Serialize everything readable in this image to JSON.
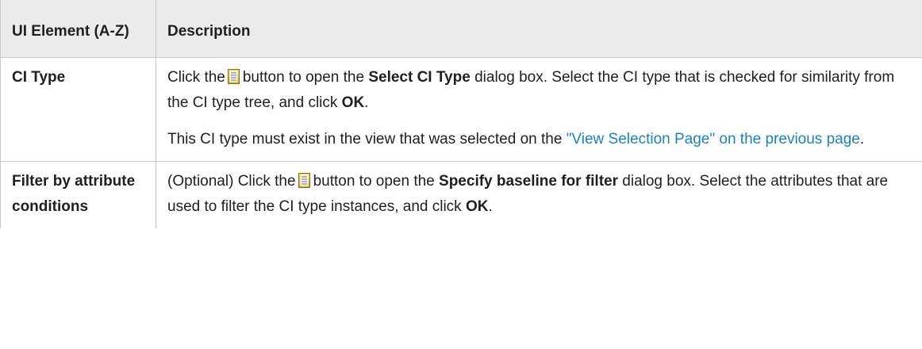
{
  "table": {
    "header": {
      "col1": "UI Element (A-Z)",
      "col2": "Description"
    },
    "rows": [
      {
        "element": "CI Type",
        "p1_before_icon": "Click the",
        "p1_after_icon": "button to open the",
        "p1_bold1": "Select CI Type",
        "p1_mid": "dialog box. Select the CI type that is checked for similarity from the CI type tree, and click",
        "p1_bold2": "OK",
        "p1_end": ".",
        "p2_text": "This CI type must exist in the view that was selected on the",
        "p2_link": "\"View Selection Page\" on the previous page",
        "p2_end": "."
      },
      {
        "element": "Filter by attribute conditions",
        "p1_before_icon": "(Optional) Click the",
        "p1_after_icon": "button to open the",
        "p1_bold1": "Specify baseline for filter",
        "p1_mid": "dialog box. Select the attributes that are used to filter the CI type instances, and click",
        "p1_bold2": "OK",
        "p1_end": "."
      }
    ],
    "icon": "list-button-icon"
  },
  "colors": {
    "header_bg": "#ebebeb",
    "link": "#1a82c4",
    "border": "#c8c8c8"
  }
}
